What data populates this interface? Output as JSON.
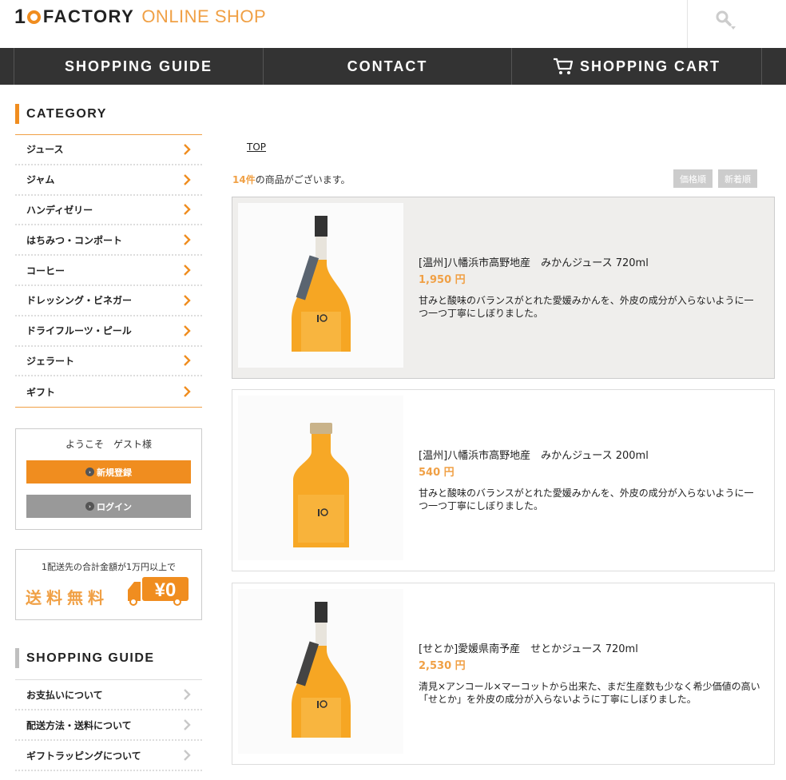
{
  "header": {
    "logo_mark": "1",
    "logo_factory": "FACTORY",
    "logo_shop": "ONLINE SHOP"
  },
  "nav": {
    "items": [
      {
        "label": "SHOPPING GUIDE"
      },
      {
        "label": "CONTACT"
      },
      {
        "label": "SHOPPING CART",
        "icon": "cart-icon"
      }
    ]
  },
  "sidebar": {
    "category_heading": "CATEGORY",
    "categories": [
      {
        "label": "ジュース"
      },
      {
        "label": "ジャム"
      },
      {
        "label": "ハンディゼリー"
      },
      {
        "label": "はちみつ・コンポート"
      },
      {
        "label": "コーヒー"
      },
      {
        "label": "ドレッシング・ビネガー"
      },
      {
        "label": "ドライフルーツ・ピール"
      },
      {
        "label": "ジェラート"
      },
      {
        "label": "ギフト"
      }
    ],
    "login": {
      "welcome": "ようこそ　ゲスト様",
      "register": "新規登録",
      "login": "ログイン"
    },
    "shipping": {
      "text": "1配送先の合計金額が1万円以上で",
      "free": "送料無料",
      "amount": "¥0"
    },
    "guide_heading": "SHOPPING GUIDE",
    "guide_items": [
      {
        "label": "お支払いについて"
      },
      {
        "label": "配送方法・送料について"
      },
      {
        "label": "ギフトラッピングについて"
      }
    ]
  },
  "main": {
    "breadcrumb": "TOP",
    "count_num": "14件",
    "count_text": "の商品がございます。",
    "sort": {
      "price": "価格順",
      "new": "新着順"
    },
    "products": [
      {
        "name": "[温州]八幡浜市高野地産　みかんジュース 720ml",
        "price": "1,950 円",
        "desc": "甘みと酸味のバランスがとれた愛媛みかんを、外皮の成分が入らないように一つ一つ丁寧にしぼりました。"
      },
      {
        "name": "[温州]八幡浜市高野地産　みかんジュース 200ml",
        "price": "540 円",
        "desc": "甘みと酸味のバランスがとれた愛媛みかんを、外皮の成分が入らないように一つ一つ丁寧にしぼりました。"
      },
      {
        "name": "[せとか]愛媛県南予産　せとかジュース 720ml",
        "price": "2,530 円",
        "desc": "清見×アンコール×マーコットから出来た、まだ生産数も少なく希少価値の高い「せとか」を外皮の成分が入らないように丁寧にしぼりました。"
      }
    ]
  },
  "colors": {
    "accent": "#f08d1f",
    "nav_bg": "#333333",
    "highlight_bg": "#efeeec"
  }
}
